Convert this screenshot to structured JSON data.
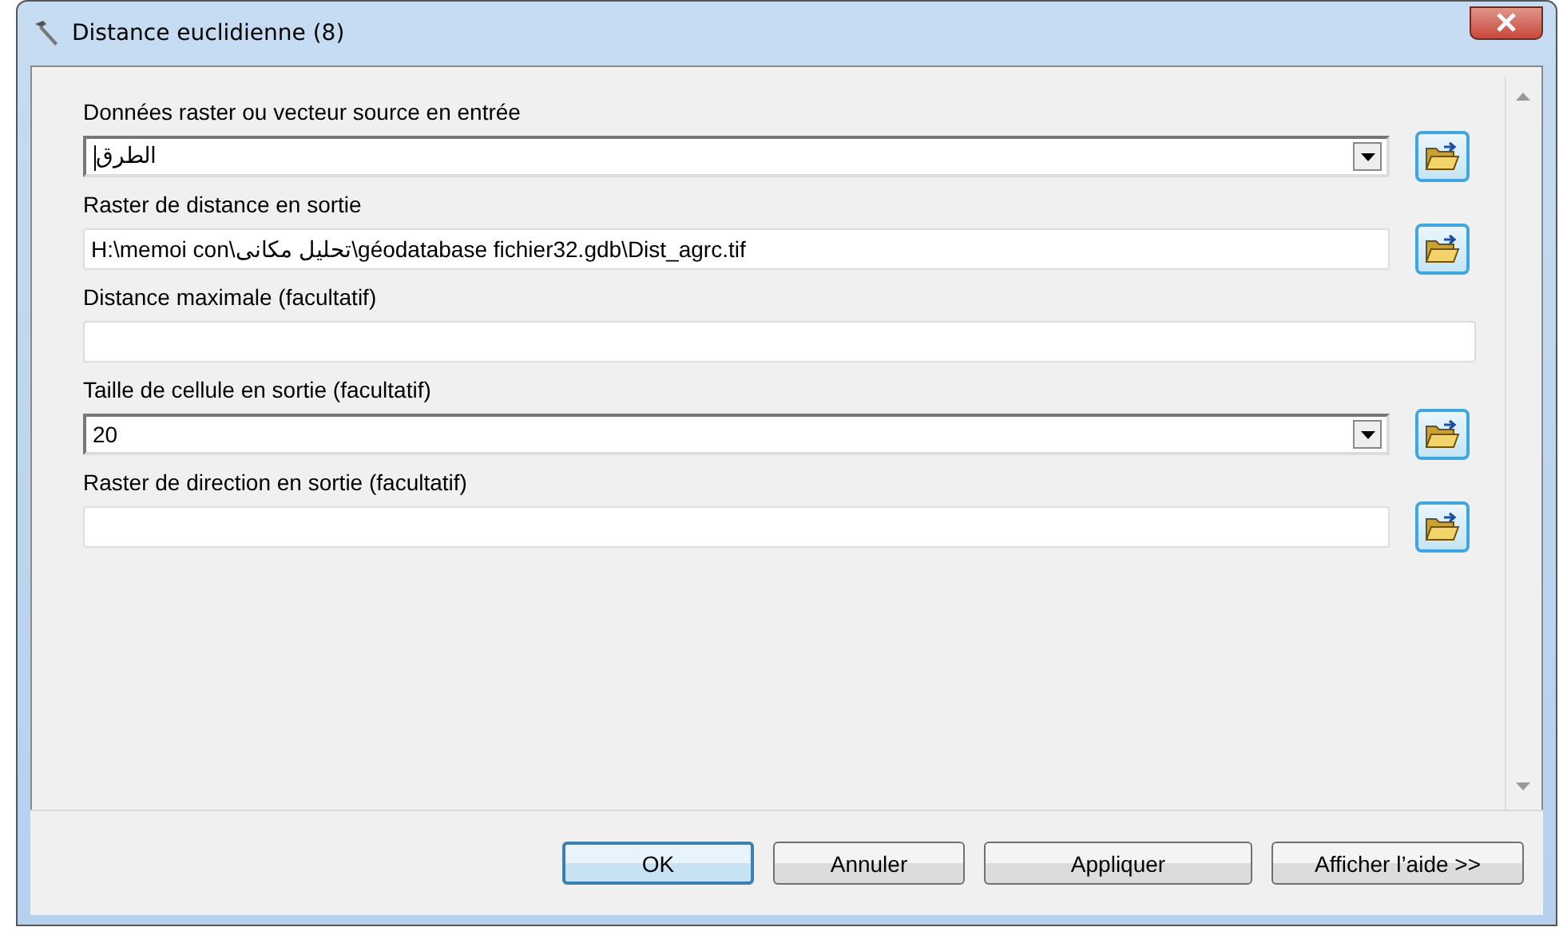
{
  "window": {
    "title": "Distance euclidienne (8)"
  },
  "fields": [
    {
      "label": "Données raster ou vecteur source en entrée",
      "kind": "combo",
      "value": "الطرق",
      "browse": true
    },
    {
      "label": "Raster de distance en sortie",
      "kind": "text",
      "value": "H:\\memoi con\\تحليل مكانى\\géodatabase fichier32.gdb\\Dist_agrc.tif",
      "browse": true
    },
    {
      "label": "Distance maximale (facultatif)",
      "kind": "text",
      "browse": false
    },
    {
      "label": "Taille de cellule en sortie (facultatif)",
      "kind": "combo",
      "value": "20",
      "browse": true
    },
    {
      "label": "Raster de direction en sortie (facultatif)",
      "kind": "text",
      "browse": true
    }
  ],
  "buttons": [
    {
      "label": "OK",
      "default": true
    },
    {
      "label": "Annuler",
      "default": false
    },
    {
      "label": "Appliquer",
      "default": false
    },
    {
      "label": "Afficher l’aide >>",
      "default": false
    }
  ]
}
